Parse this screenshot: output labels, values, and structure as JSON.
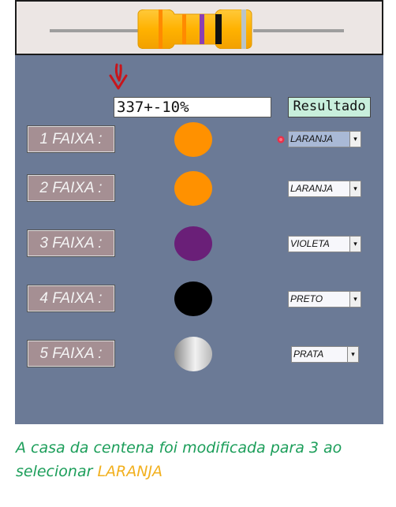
{
  "colors": {
    "panel": "#6b7a96",
    "laranja": "#ff9100",
    "violeta": "#6a1f78",
    "preto": "#000000",
    "prata": "#c9c9c9",
    "caption_text": "#1c9e5a",
    "caption_highlight": "#f2b01e"
  },
  "display": {
    "value": "337+-10%"
  },
  "result_button": {
    "label": "Resultado"
  },
  "bands": [
    {
      "label": "1 FAIXA :",
      "selected": "LARANJA",
      "color": "#ff9100"
    },
    {
      "label": "2 FAIXA :",
      "selected": "LARANJA",
      "color": "#ff9100"
    },
    {
      "label": "3 FAIXA :",
      "selected": "VIOLETA",
      "color": "#6a1f78"
    },
    {
      "label": "4 FAIXA :",
      "selected": "PRETO",
      "color": "#000000"
    },
    {
      "label": "5 FAIXA :",
      "selected": "PRATA",
      "color": "#c9c9c9"
    }
  ],
  "icons": {
    "pointer": "down-arrow-icon",
    "select_arrow": "▾",
    "marker": "red-dot-icon"
  },
  "caption": {
    "text": "A casa da centena foi modificada para 3 ao selecionar",
    "highlight": "LARANJA"
  }
}
